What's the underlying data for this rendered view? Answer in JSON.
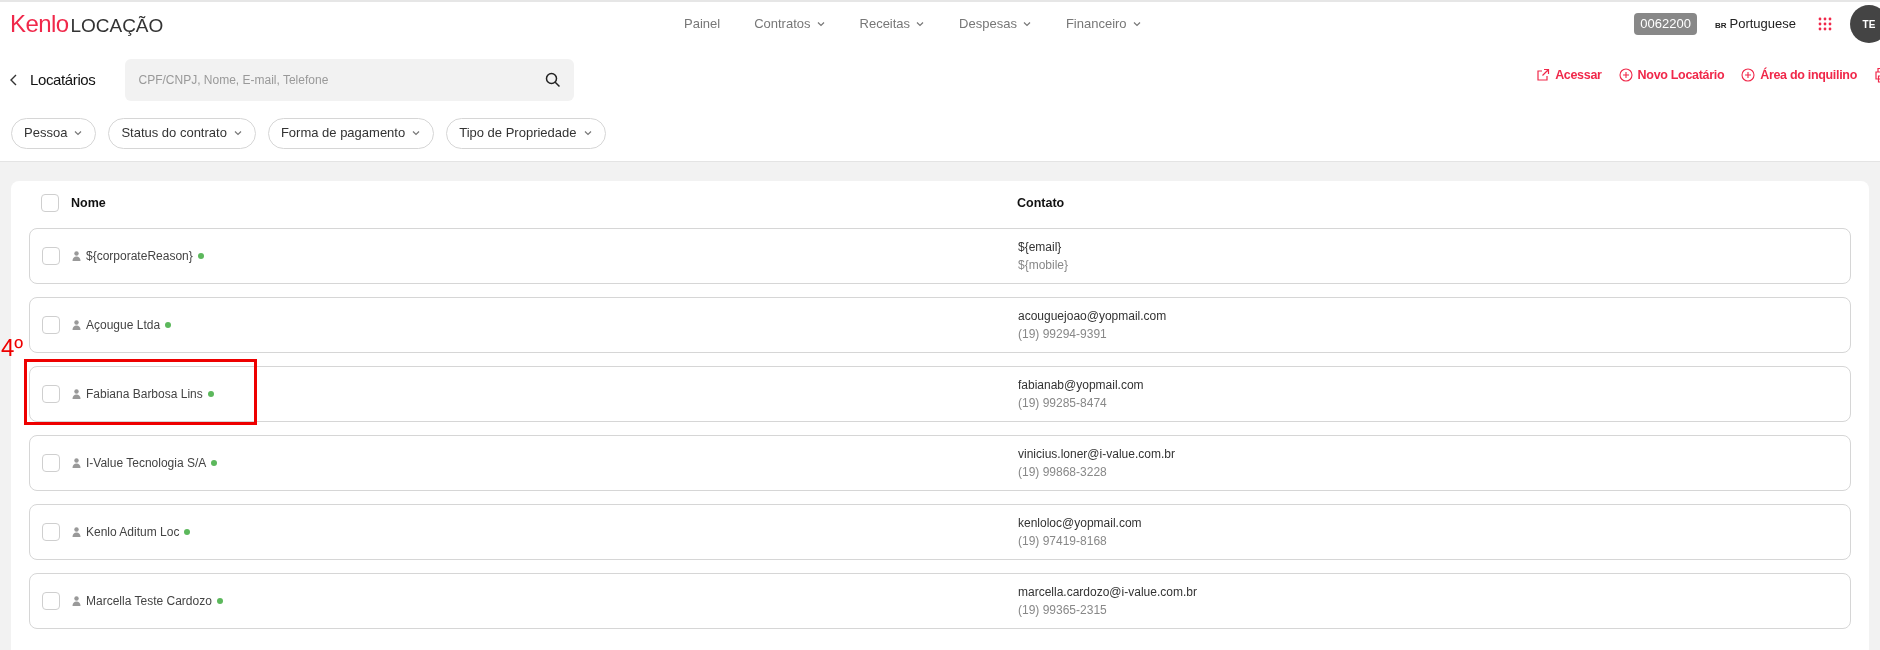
{
  "logo": {
    "brand": "Kenlo",
    "product": "LOCAÇÃO"
  },
  "nav": [
    {
      "label": "Painel",
      "dropdown": false
    },
    {
      "label": "Contratos",
      "dropdown": true
    },
    {
      "label": "Receitas",
      "dropdown": true
    },
    {
      "label": "Despesas",
      "dropdown": true
    },
    {
      "label": "Financeiro",
      "dropdown": true
    }
  ],
  "account_code": "0062200",
  "language": {
    "flag": "BR",
    "label": "Portuguese"
  },
  "avatar": "TE",
  "page_title": "Locatários",
  "search": {
    "placeholder": "CPF/CNPJ, Nome, E-mail, Telefone"
  },
  "actions": [
    {
      "label": "Acessar",
      "kind": "external"
    },
    {
      "label": "Novo Locatário",
      "kind": "add"
    },
    {
      "label": "Área do inquilino",
      "kind": "add"
    }
  ],
  "filters": [
    "Pessoa",
    "Status do contrato",
    "Forma de pagamento",
    "Tipo de Propriedade"
  ],
  "table": {
    "columns": [
      "Nome",
      "Contato"
    ],
    "all_checked": false,
    "rows": [
      {
        "name": "${corporateReason}",
        "email": "${email}",
        "phone": "${mobile}",
        "checked": false,
        "color": "#5cb85c",
        "highlighted": false
      },
      {
        "name": "Açougue Ltda",
        "email": "acouguejoao@yopmail.com",
        "phone": "(19) 99294-9391",
        "checked": false,
        "color": "#5cb85c",
        "highlighted": false
      },
      {
        "name": "Fabiana Barbosa Lins",
        "email": "fabianab@yopmail.com",
        "phone": "(19) 99285-8474",
        "checked": false,
        "color": "#5cb85c",
        "highlighted": true
      },
      {
        "name": "I-Value Tecnologia S/A",
        "email": "vinicius.loner@i-value.com.br",
        "phone": "(19) 99868-3228",
        "checked": false,
        "color": "#5cb85c",
        "highlighted": false
      },
      {
        "name": "Kenlo Aditum Loc",
        "email": "kenloloc@yopmail.com",
        "phone": "(19) 97419-8168",
        "checked": false,
        "color": "#5cb85c",
        "highlighted": false
      },
      {
        "name": "Marcella Teste Cardozo",
        "email": "marcella.cardozo@i-value.com.br",
        "phone": "(19) 99365-2315",
        "checked": false,
        "color": "#5cb85c",
        "highlighted": false
      }
    ]
  },
  "annotation": {
    "label": "4º"
  }
}
